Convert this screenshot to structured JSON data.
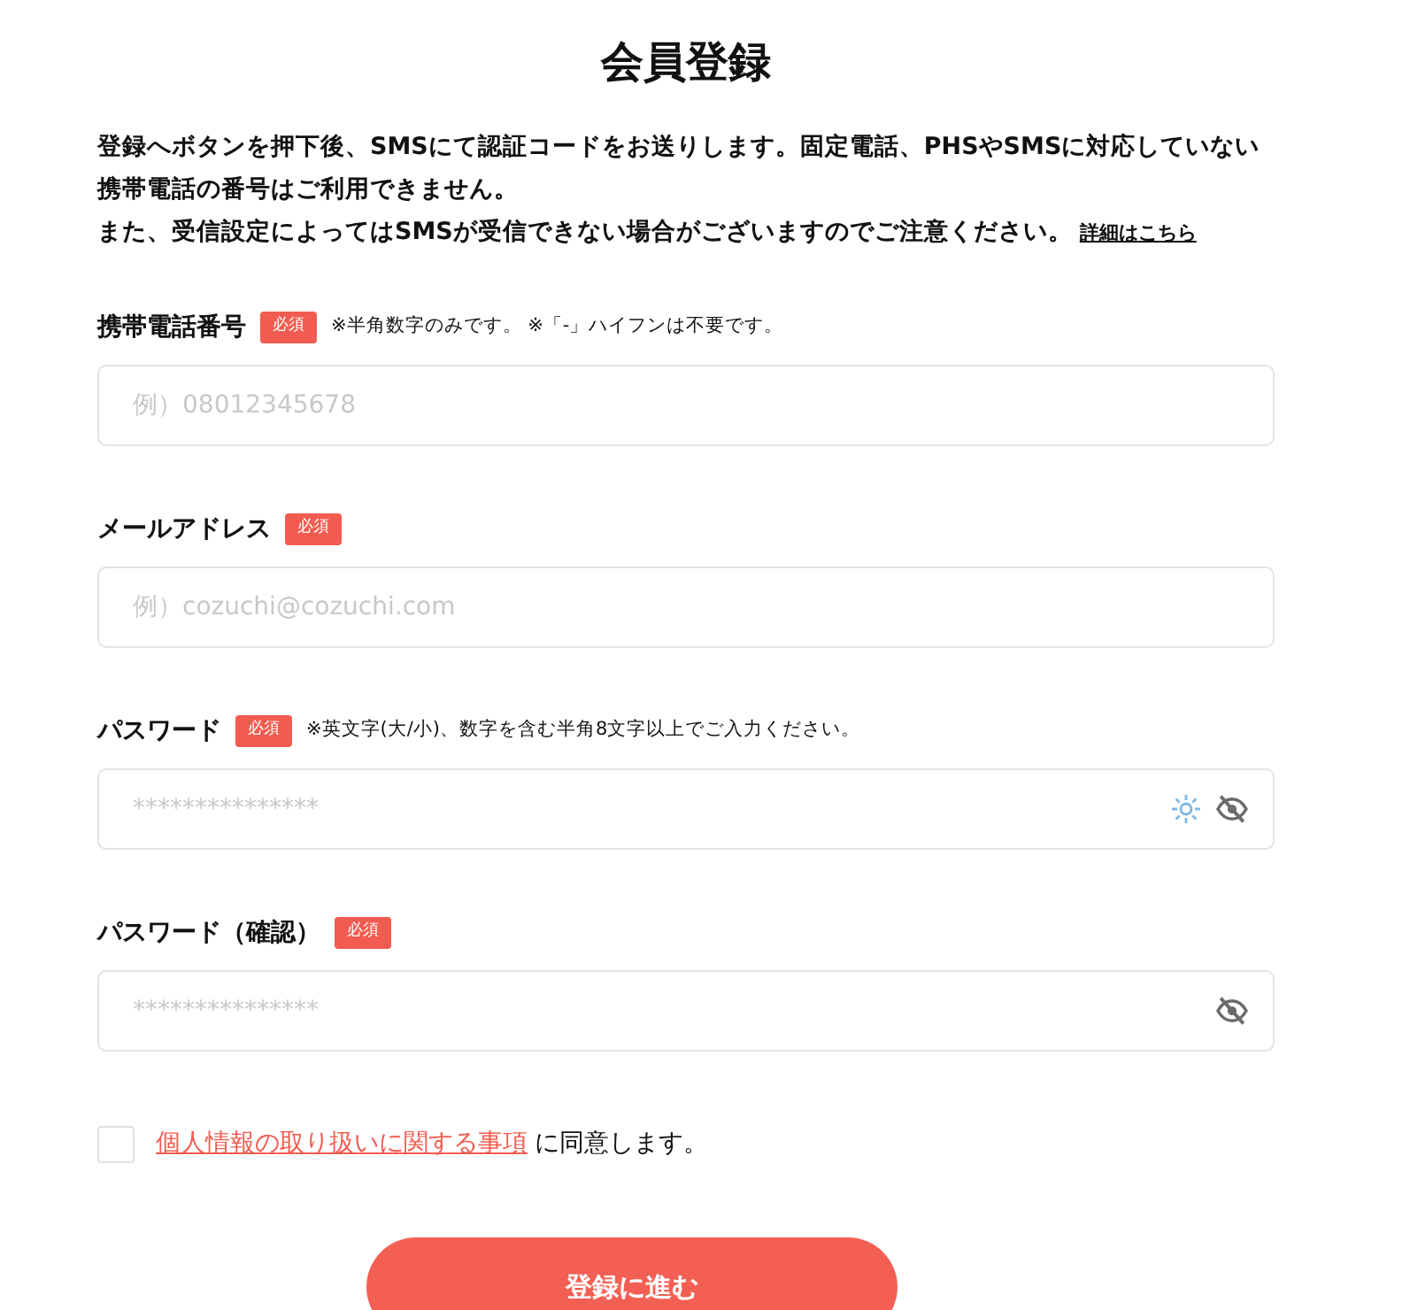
{
  "title": "会員登録",
  "intro": [
    "登録へボタンを押下後、SMSにて認証コードをお送りします。固定電話、PHSやSMSに対応していない携帯電話の番号はご利用できません。",
    "また、受信設定によってはSMSが受信できない場合がございますのでご注意ください。"
  ],
  "details_link": "詳細はこちら",
  "fields": [
    {
      "kind": "text",
      "label": "携帯電話番号",
      "required": "必須",
      "note": "※半角数字のみです。 ※「-」ハイフンは不要です。",
      "placeholder": "例）08012345678"
    },
    {
      "kind": "text",
      "label": "メールアドレス",
      "required": "必須",
      "placeholder": "例）cozuchi@cozuchi.com"
    },
    {
      "kind": "password",
      "label": "パスワード",
      "required": "必須",
      "note": "※英文字(大/小)、数字を含む半角8文字以上でご入力ください。",
      "placeholder": "***************",
      "autofill_icon": true
    },
    {
      "kind": "password",
      "label": "パスワード（確認）",
      "required": "必須",
      "placeholder": "***************",
      "autofill_icon": false
    }
  ],
  "consent": {
    "checked": false,
    "link": "個人情報の取り扱いに関する事項",
    "text": "に同意します。"
  },
  "submit": "登録に進む"
}
